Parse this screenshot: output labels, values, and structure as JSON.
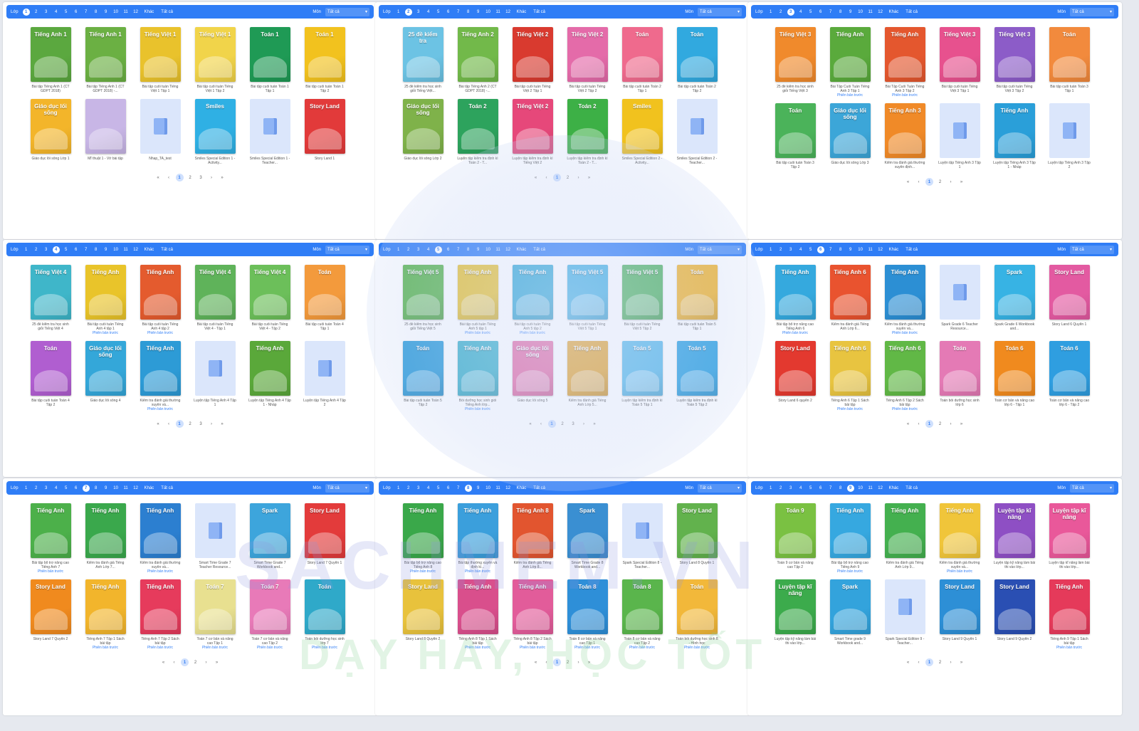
{
  "filter": {
    "grade_label": "Lớp",
    "subject_label": "Môn",
    "subject_value": "Tất cả",
    "grades": [
      "1",
      "2",
      "3",
      "4",
      "5",
      "6",
      "7",
      "8",
      "9",
      "10",
      "11",
      "12",
      "Khác",
      "Tất cả"
    ]
  },
  "icons": {
    "dropdown": "chevron-down-icon",
    "book_placeholder": "book-icon",
    "page_first": "«",
    "page_prev": "‹",
    "page_next": "›",
    "page_last": "»"
  },
  "colors": {
    "accent": "#2f7df6",
    "page_bg": "#ffffff",
    "placeholder": "#dbe6fb"
  },
  "panels": [
    {
      "active_grade": "1",
      "pages": [
        "1",
        "2",
        "3"
      ],
      "books": [
        {
          "title": "Tiếng Anh 1",
          "caption": "Bài tập Tiếng Anh 1 (CT GDPT 2018)",
          "color": "#5ba83f",
          "prev": false
        },
        {
          "title": "Tiếng Anh 1",
          "caption": "Bài tập Tiếng Anh 1 (CT GDPT 2018) -...",
          "color": "#6bb043",
          "prev": false
        },
        {
          "title": "Tiếng Việt 1",
          "caption": "Bài tập cuối tuần Tiếng Việt 1 Tập 1",
          "color": "#e9c22c",
          "prev": false
        },
        {
          "title": "Tiếng Việt 1",
          "caption": "Bài tập cuối tuần Tiếng Việt 1 Tập 2",
          "color": "#f1d44a",
          "prev": false
        },
        {
          "title": "Toán 1",
          "caption": "Bài tập cuối tuần Toán 1 Tập 1",
          "color": "#1f9a55",
          "prev": false
        },
        {
          "title": "Toán 1",
          "caption": "Bài tập cuối tuần Toán 1 Tập 2",
          "color": "#f2c21e",
          "prev": false
        },
        {
          "title": "Giáo dục lối sống",
          "caption": "Giáo dục lối sống Lớp 1",
          "color": "#f3b52a",
          "prev": false
        },
        {
          "title": "",
          "caption": "Mĩ thuật 1 - Vở bài tập",
          "color": "#c8b6e6",
          "prev": false
        },
        {
          "title": "",
          "caption": "Nhap_TA_test",
          "color": "",
          "prev": false
        },
        {
          "title": "Smiles",
          "caption": "Smiles Special Edition 1 - Activity...",
          "color": "#2fb0e4",
          "prev": false
        },
        {
          "title": "",
          "caption": "Smiles Special Edition 1 - Teacher...",
          "color": "",
          "prev": false
        },
        {
          "title": "Story Land",
          "caption": "Story Land 1",
          "color": "#e23a3a",
          "prev": false
        }
      ]
    },
    {
      "active_grade": "2",
      "pages": [
        "1",
        "2"
      ],
      "books": [
        {
          "title": "25 đề kiểm tra",
          "caption": "25 đề kiểm tra học sinh giỏi Tiếng Việt...",
          "color": "#6cc3e4",
          "prev": false
        },
        {
          "title": "Tiếng Anh 2",
          "caption": "Bài tập Tiếng Anh 2 (CT GDPT 2018) -...",
          "color": "#72b94a",
          "prev": false
        },
        {
          "title": "Tiếng Việt 2",
          "caption": "Bài tập cuối tuần Tiếng Việt 2 Tập 1",
          "color": "#d93a2f",
          "prev": false
        },
        {
          "title": "Tiếng Việt 2",
          "caption": "Bài tập cuối tuần Tiếng Việt 2 Tập 2",
          "color": "#e46ba9",
          "prev": false
        },
        {
          "title": "Toán",
          "caption": "Bài tập cuối tuần Toán 2 Tập 1",
          "color": "#ef6a8d",
          "prev": false
        },
        {
          "title": "Toán",
          "caption": "Bài tập cuối tuần Toán 2 Tập 2",
          "color": "#31a9df",
          "prev": false
        },
        {
          "title": "Giáo dục lối sống",
          "caption": "Giáo dục lối sống Lớp 2",
          "color": "#7fb24a",
          "prev": false
        },
        {
          "title": "Toán 2",
          "caption": "Luyện tập kiểm tra định kì Toán 2 - T...",
          "color": "#2da35d",
          "prev": false
        },
        {
          "title": "Tiếng Việt 2",
          "caption": "Luyện tập kiểm tra định kì Tiếng Việt 2",
          "color": "#e6487a",
          "prev": false
        },
        {
          "title": "Toán 2",
          "caption": "Luyện tập kiểm tra định kì Toán 2 - T...",
          "color": "#3db046",
          "prev": false
        },
        {
          "title": "Smiles",
          "caption": "Smiles Special Edition 2 - Activity...",
          "color": "#f1c21e",
          "prev": false
        },
        {
          "title": "",
          "caption": "Smiles Special Edition 2 - Teacher...",
          "color": "",
          "prev": false
        }
      ]
    },
    {
      "active_grade": "3",
      "pages": [
        "1",
        "2"
      ],
      "books": [
        {
          "title": "Tiếng Việt 3",
          "caption": "25 đề kiểm tra học sinh giỏi Tiếng Việt 3",
          "color": "#f08a2c",
          "prev": false
        },
        {
          "title": "Tiếng Anh",
          "caption": "Bài Tập Cuối Tuần Tiếng Anh 3 Tập 1",
          "color": "#5aaa3c",
          "prev": true
        },
        {
          "title": "Tiếng Anh",
          "caption": "Bài Tập Cuối Tuần Tiếng Anh 3 Tập 2",
          "color": "#e4572e",
          "prev": true
        },
        {
          "title": "Tiếng Việt 3",
          "caption": "Bài tập cuối tuần Tiếng Việt 3 Tập 1",
          "color": "#e7518e",
          "prev": false
        },
        {
          "title": "Tiếng Việt 3",
          "caption": "Bài tập cuối tuần Tiếng Việt 3 Tập 2",
          "color": "#8c5cc8",
          "prev": false
        },
        {
          "title": "Toán",
          "caption": "Bài tập cuối tuần Toán 3 Tập 1",
          "color": "#f28a3d",
          "prev": false
        },
        {
          "title": "Toán",
          "caption": "Bài tập cuối tuần Toán 3 Tập 2",
          "color": "#4bb35a",
          "prev": false
        },
        {
          "title": "Giáo dục lối sống",
          "caption": "Giáo dục lối sống Lớp 3",
          "color": "#3ca6d8",
          "prev": false
        },
        {
          "title": "Tiếng Anh 3",
          "caption": "Kiểm tra đánh giá thường xuyên định...",
          "color": "#f08a28",
          "prev": false
        },
        {
          "title": "",
          "caption": "Luyện tập Tiếng Anh 3 Tập 1",
          "color": "",
          "prev": false
        },
        {
          "title": "Tiếng Anh",
          "caption": "Luyện tập Tiếng Anh 3 Tập 1 - Nháp",
          "color": "#2a9fd9",
          "prev": false
        },
        {
          "title": "",
          "caption": "Luyện tập Tiếng Anh 3 Tập 2",
          "color": "",
          "prev": false
        }
      ]
    },
    {
      "active_grade": "4",
      "pages": [
        "1",
        "2",
        "3"
      ],
      "books": [
        {
          "title": "Tiếng Việt 4",
          "caption": "25 đề kiểm tra học sinh giỏi Tiếng Việt 4",
          "color": "#3fb6c9",
          "prev": false
        },
        {
          "title": "Tiếng Anh",
          "caption": "Bài tập cuối tuần Tiếng Anh 4 tập 1",
          "color": "#e9c42a",
          "prev": true
        },
        {
          "title": "Tiếng Anh",
          "caption": "Bài tập cuối tuần Tiếng Anh 4 tập 2",
          "color": "#e45b2e",
          "prev": true
        },
        {
          "title": "Tiếng Việt 4",
          "caption": "Bài tập cuối tuần Tiếng Việt 4 - Tập 1",
          "color": "#5fb35a",
          "prev": false
        },
        {
          "title": "Tiếng Việt 4",
          "caption": "Bài tập cuối tuần Tiếng Việt 4 - Tập 2",
          "color": "#6cbf5a",
          "prev": false
        },
        {
          "title": "Toán",
          "caption": "Bài tập cuối tuần Toán 4 Tập 1",
          "color": "#f39a3c",
          "prev": false
        },
        {
          "title": "Toán",
          "caption": "Bài tập cuối tuần Toán 4 Tập 2",
          "color": "#b05ed0",
          "prev": false
        },
        {
          "title": "Giáo dục lối sống",
          "caption": "Giáo dục lối sống 4",
          "color": "#34a7d9",
          "prev": false
        },
        {
          "title": "Tiếng Anh",
          "caption": "Kiểm tra đánh giá thường xuyên và...",
          "color": "#2d9bd6",
          "prev": true
        },
        {
          "title": "",
          "caption": "Luyện tập Tiếng Anh 4 Tập 1",
          "color": "",
          "prev": false
        },
        {
          "title": "Tiếng Anh",
          "caption": "Luyện tập Tiếng Anh 4 Tập 1 - Nháp",
          "color": "#5aa83a",
          "prev": false
        },
        {
          "title": "",
          "caption": "Luyện tập Tiếng Anh 4 Tập 2",
          "color": "",
          "prev": false
        }
      ]
    },
    {
      "active_grade": "5",
      "pages": [
        "1",
        "2",
        "3"
      ],
      "books": [
        {
          "title": "Tiếng Việt 5",
          "caption": "25 đề kiểm tra học sinh giỏi Tiếng Việt 5",
          "color": "#59b54b",
          "prev": false
        },
        {
          "title": "Tiếng Anh",
          "caption": "Bài tập cuối tuần Tiếng Anh 5 tập 1",
          "color": "#e7c12e",
          "prev": true
        },
        {
          "title": "Tiếng Anh",
          "caption": "Bài tập cuối tuần Tiếng Anh 5 tập 2",
          "color": "#2fa7d4",
          "prev": true
        },
        {
          "title": "Tiếng Việt 5",
          "caption": "Bài tập cuối tuần Tiếng Việt 5 Tập 1",
          "color": "#3daee0",
          "prev": false
        },
        {
          "title": "Tiếng Việt 5",
          "caption": "Bài tập cuối tuần Tiếng Việt 5 Tập 2",
          "color": "#4fb35e",
          "prev": false
        },
        {
          "title": "Toán",
          "caption": "Bài tập cuối tuần Toán 5 Tập 1",
          "color": "#f3b52c",
          "prev": false
        },
        {
          "title": "Toán",
          "caption": "Bài tập cuối tuần Toán 5 Tập 2",
          "color": "#2a9bd8",
          "prev": false
        },
        {
          "title": "Tiếng Anh",
          "caption": "Bồi dưỡng học sinh giỏi Tiếng Anh lớp...",
          "color": "#3ab0c9",
          "prev": true
        },
        {
          "title": "Giáo dục lối sống",
          "caption": "Giáo dục lối sống 5",
          "color": "#e46aa4",
          "prev": false
        },
        {
          "title": "Tiếng Anh",
          "caption": "Kiểm tra đánh giá Tiếng Anh Lớp 5...",
          "color": "#e2a22c",
          "prev": false
        },
        {
          "title": "Toán 5",
          "caption": "Luyện tập kiểm tra định kì Toán 5 Tập 1",
          "color": "#57b9e8",
          "prev": false
        },
        {
          "title": "Toán 5",
          "caption": "Luyện tập kiểm tra định kì Toán 5 Tập 2",
          "color": "#2ba1e0",
          "prev": false
        }
      ]
    },
    {
      "active_grade": "6",
      "pages": [
        "1",
        "2"
      ],
      "books": [
        {
          "title": "Tiếng Anh",
          "caption": "Bài tập bổ trợ nâng cao Tiếng Anh 6",
          "color": "#35a9de",
          "prev": true
        },
        {
          "title": "Tiếng Anh 6",
          "caption": "Kiểm tra đánh giá Tiếng Anh Lớp 6...",
          "color": "#e9532f",
          "prev": false
        },
        {
          "title": "Tiếng Anh",
          "caption": "Kiểm tra đánh giá thường xuyên và...",
          "color": "#2c8fd4",
          "prev": true
        },
        {
          "title": "",
          "caption": "Spark Grade 6 Teacher Resource...",
          "color": "",
          "prev": false
        },
        {
          "title": "Spark",
          "caption": "Spark Grade 6 Workbook and...",
          "color": "#37b3e4",
          "prev": false
        },
        {
          "title": "Story Land",
          "caption": "Story Land 6 Quyển 1",
          "color": "#e35aa1",
          "prev": false
        },
        {
          "title": "Story Land",
          "caption": "Story Land 6 quyển 2",
          "color": "#e3392f",
          "prev": false
        },
        {
          "title": "Tiếng Anh 6",
          "caption": "Tiếng Anh 6 Tập 1 Sách bài tập",
          "color": "#e8c440",
          "prev": true
        },
        {
          "title": "Tiếng Anh 6",
          "caption": "Tiếng Anh 6 Tập 2 Sách bài tập",
          "color": "#61b846",
          "prev": true
        },
        {
          "title": "Toán",
          "caption": "Toán bồi dưỡng học sinh lớp 6",
          "color": "#e47ab5",
          "prev": false
        },
        {
          "title": "Toán 6",
          "caption": "Toán cơ bản và nâng cao lớp 6 - Tập 1",
          "color": "#f08a1e",
          "prev": false
        },
        {
          "title": "Toán 6",
          "caption": "Toán cơ bản và nâng cao lớp 6 - Tập 2",
          "color": "#2f9ee0",
          "prev": false
        }
      ]
    },
    {
      "active_grade": "7",
      "pages": [
        "1",
        "2"
      ],
      "books": [
        {
          "title": "Tiếng Anh",
          "caption": "Bài tập bổ trợ nâng cao Tiếng Anh 7",
          "color": "#4cb04a",
          "prev": true
        },
        {
          "title": "Tiếng Anh",
          "caption": "Kiểm tra đánh giá Tiếng Anh Lớp 7...",
          "color": "#3aa84c",
          "prev": false
        },
        {
          "title": "Tiếng Anh",
          "caption": "Kiểm tra đánh giá thường xuyên và...",
          "color": "#2c7fd0",
          "prev": true
        },
        {
          "title": "",
          "caption": "Smart Time Grade 7 Teacher Resource...",
          "color": "",
          "prev": false
        },
        {
          "title": "Spark",
          "caption": "Smart Time Grade 7 Workbook and...",
          "color": "#3da5dc",
          "prev": false
        },
        {
          "title": "Story Land",
          "caption": "Story Land 7 Quyển 1",
          "color": "#e33b3b",
          "prev": false
        },
        {
          "title": "Story Land",
          "caption": "Story Land 7 Quyển 2",
          "color": "#f08a1e",
          "prev": false
        },
        {
          "title": "Tiếng Anh",
          "caption": "Tiếng Anh 7 Tập 1 Sách bài tập",
          "color": "#f2b52c",
          "prev": true
        },
        {
          "title": "Tiếng Anh",
          "caption": "Tiếng Anh 7 Tập 2 Sách bài tập",
          "color": "#e63b5c",
          "prev": true
        },
        {
          "title": "Toán 7",
          "caption": "Toán 7 cơ bản và nâng cao Tập 1",
          "color": "#e8e090",
          "prev": true
        },
        {
          "title": "Toán 7",
          "caption": "Toán 7 cơ bản và nâng cao Tập 2",
          "color": "#e87ab8",
          "prev": true
        },
        {
          "title": "Toán",
          "caption": "Toán bồi dưỡng học sinh lớp 7",
          "color": "#2fa9c9",
          "prev": true
        }
      ]
    },
    {
      "active_grade": "8",
      "pages": [
        "1",
        "2"
      ],
      "books": [
        {
          "title": "Tiếng Anh",
          "caption": "Bài tập bổ trợ nâng cao Tiếng Anh 8",
          "color": "#3aa84a",
          "prev": true
        },
        {
          "title": "Tiếng Anh",
          "caption": "Bài tập thường xuyên và định kì...",
          "color": "#3b9fdc",
          "prev": true
        },
        {
          "title": "Tiếng Anh 8",
          "caption": "Kiểm tra đánh giá Tiếng Anh Lớp 8...",
          "color": "#e2552f",
          "prev": false
        },
        {
          "title": "Spark",
          "caption": "Smart Time Grade 8 Workbook and...",
          "color": "#3a8fd2",
          "prev": false
        },
        {
          "title": "",
          "caption": "Spark Special Edition 8 - Teacher...",
          "color": "",
          "prev": false
        },
        {
          "title": "Story Land",
          "caption": "Story Land 8 Quyển 1",
          "color": "#62b24d",
          "prev": false
        },
        {
          "title": "Story Land",
          "caption": "Story Land 8 Quyển 2",
          "color": "#e8c23c",
          "prev": false
        },
        {
          "title": "Tiếng Anh",
          "caption": "Tiếng Anh 8 Tập 1 Sách bài tập",
          "color": "#d94f8c",
          "prev": true
        },
        {
          "title": "Tiếng Anh",
          "caption": "Tiếng Anh 8 Tập 2 Sách bài tập",
          "color": "#e25c9a",
          "prev": true
        },
        {
          "title": "Toán 8",
          "caption": "Toán 8 cơ bản và nâng cao Tập 1",
          "color": "#2e8fd8",
          "prev": true
        },
        {
          "title": "Toán 8",
          "caption": "Toán 8 cơ bản và nâng cao Tập 2",
          "color": "#5ab54c",
          "prev": true
        },
        {
          "title": "Toán",
          "caption": "Toán bồi dưỡng học sinh 8 - Hình học",
          "color": "#f2b83a",
          "prev": true
        }
      ]
    },
    {
      "active_grade": "9",
      "pages": [
        "1",
        "2"
      ],
      "books": [
        {
          "title": "Toán 9",
          "caption": "Toán 9 cơ bản và nâng cao Tập 2",
          "color": "#7ac142",
          "prev": false
        },
        {
          "title": "Tiếng Anh",
          "caption": "Bài tập bổ trợ nâng cao Tiếng Anh 9",
          "color": "#36a8e0",
          "prev": true
        },
        {
          "title": "Tiếng Anh",
          "caption": "Kiểm tra đánh giá Tiếng Anh Lớp 9...",
          "color": "#44b04f",
          "prev": false
        },
        {
          "title": "Tiếng Anh",
          "caption": "Kiểm tra đánh giá thường xuyên và...",
          "color": "#f0c53a",
          "prev": true
        },
        {
          "title": "Luyện tập kĩ năng",
          "caption": "Luyện tập kỹ năng làm bài thi vào lớp...",
          "color": "#8e4fc4",
          "prev": false
        },
        {
          "title": "Luyện tập kĩ năng",
          "caption": "Luyện tập kĩ năng làm bài thi vào lớp...",
          "color": "#e9589a",
          "prev": false
        },
        {
          "title": "Luyện tập kĩ năng",
          "caption": "Luyện tập kỹ năng làm bài thi vào lớp...",
          "color": "#3cab4c",
          "prev": false
        },
        {
          "title": "Spark",
          "caption": "Smart Time grade 9 Workbook and...",
          "color": "#33a3dc",
          "prev": false
        },
        {
          "title": "",
          "caption": "Spark Special Edition 9 - Teacher...",
          "color": "",
          "prev": false
        },
        {
          "title": "Story Land",
          "caption": "Story Land 9 Quyển 1",
          "color": "#2d8fd6",
          "prev": false
        },
        {
          "title": "Story Land",
          "caption": "Story Land 9 Quyển 2",
          "color": "#2a4fb3",
          "prev": false
        },
        {
          "title": "Tiếng Anh",
          "caption": "Tiếng Anh 9 Tập 1 Sách bài tập",
          "color": "#e53a5a",
          "prev": true
        }
      ]
    }
  ],
  "preview_label": "Phiên bản trước",
  "watermark": {
    "site": "SACHMEM.VN",
    "slogan": "DẠY HAY, HỌC TỐT"
  }
}
